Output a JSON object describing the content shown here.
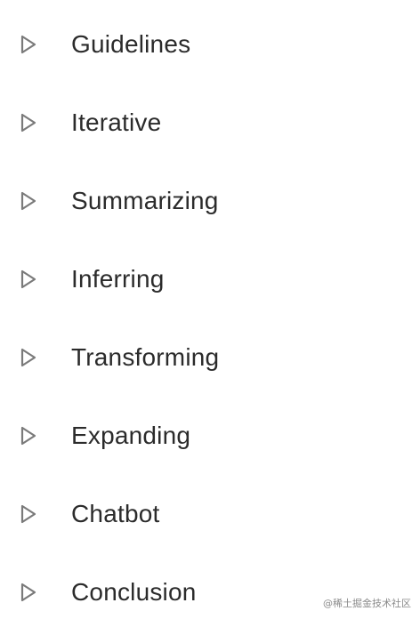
{
  "items": [
    {
      "label": "Guidelines"
    },
    {
      "label": "Iterative"
    },
    {
      "label": "Summarizing"
    },
    {
      "label": "Inferring"
    },
    {
      "label": "Transforming"
    },
    {
      "label": "Expanding"
    },
    {
      "label": "Chatbot"
    },
    {
      "label": "Conclusion"
    }
  ],
  "icon": "triangle-right-icon",
  "colors": {
    "text": "#2b2b2b",
    "icon_stroke": "#7a7a7a",
    "background": "#ffffff"
  },
  "watermark": "@稀土掘金技术社区"
}
